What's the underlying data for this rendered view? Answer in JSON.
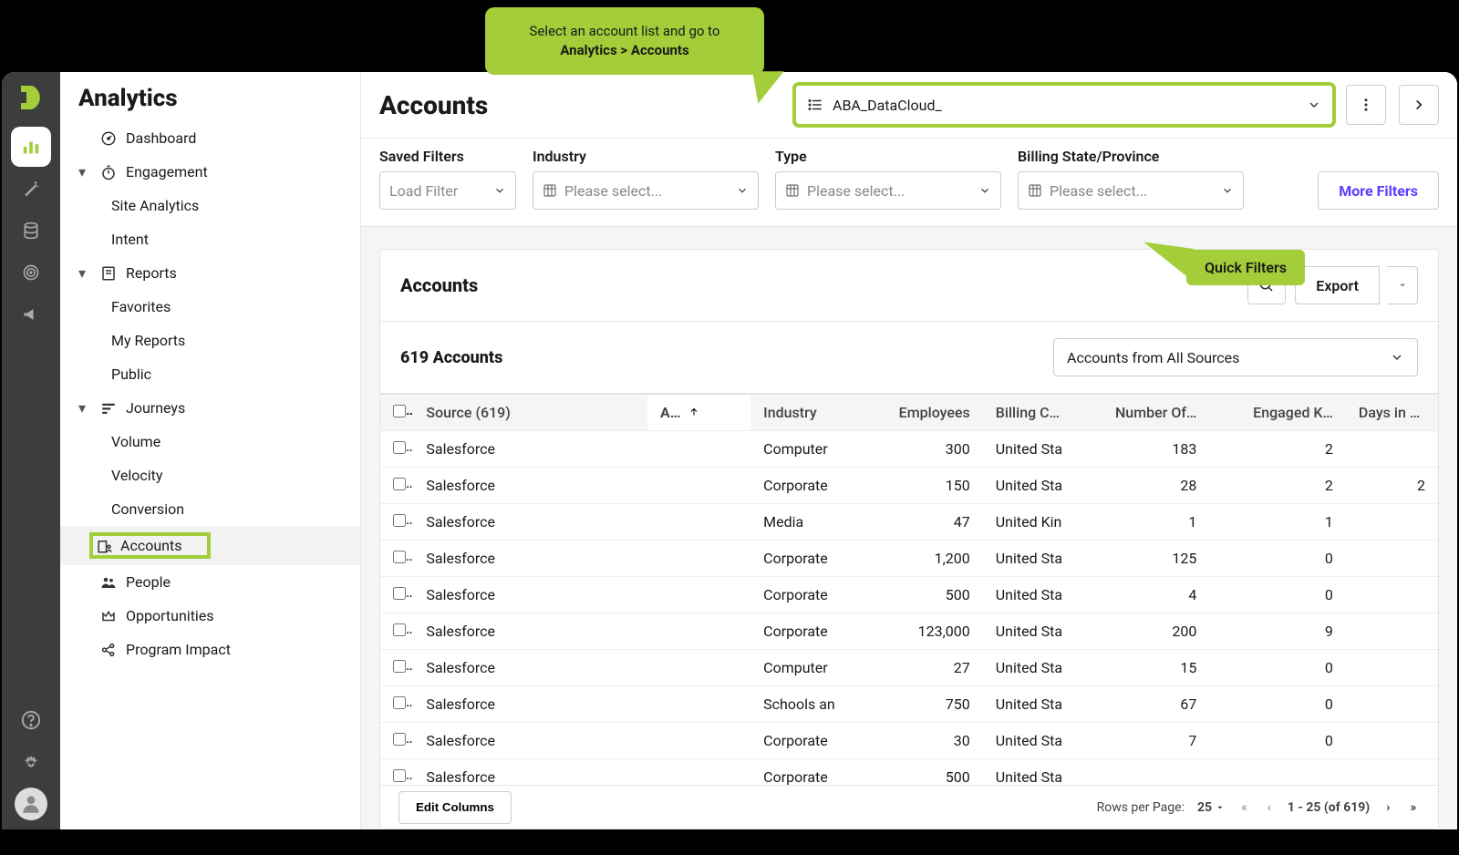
{
  "callouts": {
    "select_list_line1": "Select an account list and go to",
    "select_list_line2_bold": "Analytics > Accounts",
    "quick_filters": "Quick Filters"
  },
  "sidebar": {
    "title": "Analytics",
    "items": [
      {
        "label": "Dashboard",
        "icon": "gauge",
        "level": 0
      },
      {
        "label": "Engagement",
        "icon": "stopwatch",
        "level": 0,
        "caret": true
      },
      {
        "label": "Site Analytics",
        "level": 1
      },
      {
        "label": "Intent",
        "level": 1
      },
      {
        "label": "Reports",
        "icon": "report",
        "level": 0,
        "caret": true
      },
      {
        "label": "Favorites",
        "level": 1
      },
      {
        "label": "My Reports",
        "level": 1
      },
      {
        "label": "Public",
        "level": 1
      },
      {
        "label": "Journeys",
        "icon": "journey",
        "level": 0,
        "caret": true
      },
      {
        "label": "Volume",
        "level": 1
      },
      {
        "label": "Velocity",
        "level": 1
      },
      {
        "label": "Conversion",
        "level": 1
      },
      {
        "label": "Accounts",
        "icon": "accounts",
        "level": 1,
        "selected": true
      },
      {
        "label": "People",
        "icon": "people",
        "level": 0
      },
      {
        "label": "Opportunities",
        "icon": "crown",
        "level": 0
      },
      {
        "label": "Program Impact",
        "icon": "share",
        "level": 0
      }
    ]
  },
  "header": {
    "page_title": "Accounts",
    "list_value": "ABA_DataCloud_"
  },
  "filters": {
    "saved_label": "Saved Filters",
    "saved_placeholder": "Load Filter",
    "industry_label": "Industry",
    "industry_placeholder": "Please select...",
    "type_label": "Type",
    "type_placeholder": "Please select...",
    "billing_label": "Billing State/Province",
    "billing_placeholder": "Please select...",
    "more": "More Filters"
  },
  "panel": {
    "title": "Accounts",
    "export": "Export",
    "count_label": "619 Accounts",
    "source_select": "Accounts from All Sources"
  },
  "table": {
    "columns": [
      "Source (619)",
      "A…",
      "Industry",
      "Employees",
      "Billing C…",
      "Number Of…",
      "Engaged K…",
      "Days in Jo"
    ],
    "rows": [
      {
        "source": "Salesforce",
        "industry": "Computer",
        "employees": "300",
        "billing": "United Sta",
        "number": "183",
        "engaged": "2",
        "days": ""
      },
      {
        "source": "Salesforce",
        "industry": "Corporate",
        "employees": "150",
        "billing": "United Sta",
        "number": "28",
        "engaged": "2",
        "days": "2"
      },
      {
        "source": "Salesforce",
        "industry": "Media",
        "employees": "47",
        "billing": "United Kin",
        "number": "1",
        "engaged": "1",
        "days": ""
      },
      {
        "source": "Salesforce",
        "industry": "Corporate",
        "employees": "1,200",
        "billing": "United Sta",
        "number": "125",
        "engaged": "0",
        "days": ""
      },
      {
        "source": "Salesforce",
        "industry": "Corporate",
        "employees": "500",
        "billing": "United Sta",
        "number": "4",
        "engaged": "0",
        "days": ""
      },
      {
        "source": "Salesforce",
        "industry": "Corporate",
        "employees": "123,000",
        "billing": "United Sta",
        "number": "200",
        "engaged": "9",
        "days": ""
      },
      {
        "source": "Salesforce",
        "industry": "Computer",
        "employees": "27",
        "billing": "United Sta",
        "number": "15",
        "engaged": "0",
        "days": ""
      },
      {
        "source": "Salesforce",
        "industry": "Schools an",
        "employees": "750",
        "billing": "United Sta",
        "number": "67",
        "engaged": "0",
        "days": ""
      },
      {
        "source": "Salesforce",
        "industry": "Corporate",
        "employees": "30",
        "billing": "United Sta",
        "number": "7",
        "engaged": "0",
        "days": ""
      },
      {
        "source": "Salesforce",
        "industry": "Corporate",
        "employees": "500",
        "billing": "United Sta",
        "number": "",
        "engaged": "",
        "days": ""
      }
    ]
  },
  "pagination": {
    "edit_columns": "Edit Columns",
    "rows_per_page_label": "Rows per Page:",
    "rows_per_page_value": "25",
    "range": "1 - 25 (of 619)"
  }
}
